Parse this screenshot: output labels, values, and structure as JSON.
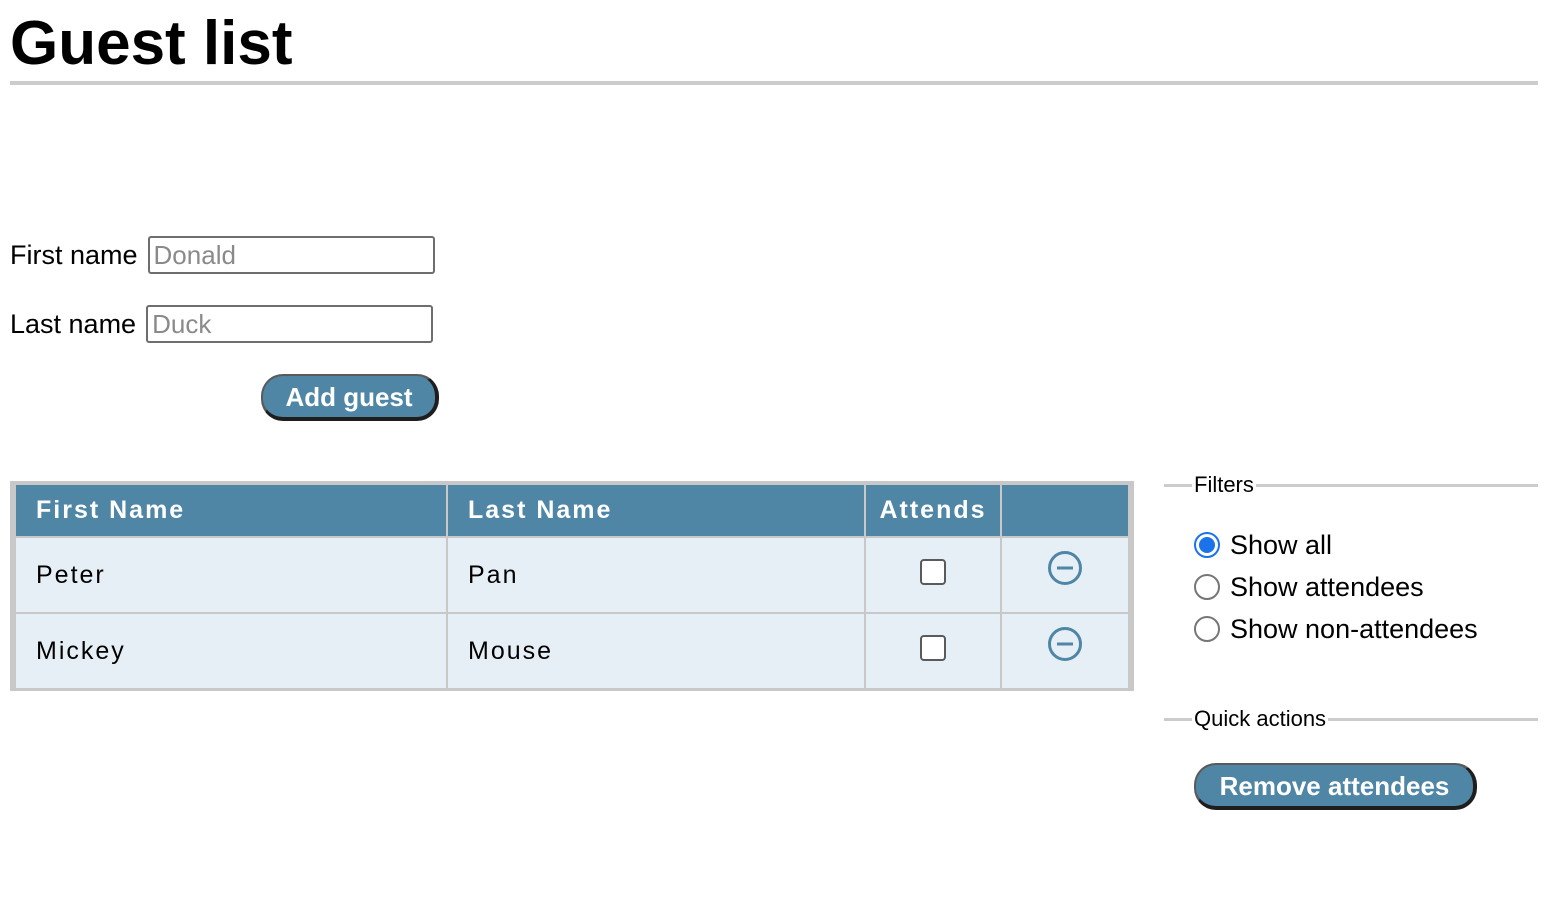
{
  "page": {
    "title": "Guest list"
  },
  "form": {
    "first_name_label": "First name",
    "first_name_placeholder": "Donald",
    "last_name_label": "Last name",
    "last_name_placeholder": "Duck",
    "add_button": "Add guest"
  },
  "table": {
    "headers": [
      "First Name",
      "Last Name",
      "Attends",
      ""
    ],
    "rows": [
      {
        "first": "Peter",
        "last": "Pan",
        "attends": false
      },
      {
        "first": "Mickey",
        "last": "Mouse",
        "attends": false
      }
    ]
  },
  "filters": {
    "legend": "Filters",
    "options": [
      {
        "label": "Show all",
        "checked": true
      },
      {
        "label": "Show attendees",
        "checked": false
      },
      {
        "label": "Show non-attendees",
        "checked": false
      }
    ]
  },
  "quick_actions": {
    "legend": "Quick actions",
    "remove_button": "Remove attendees"
  },
  "colors": {
    "accent": "#4f86a6",
    "row_bg": "#e6eff5",
    "radio_checked": "#1a73e8"
  },
  "icons": {
    "remove_row": "minus-circle-icon"
  }
}
